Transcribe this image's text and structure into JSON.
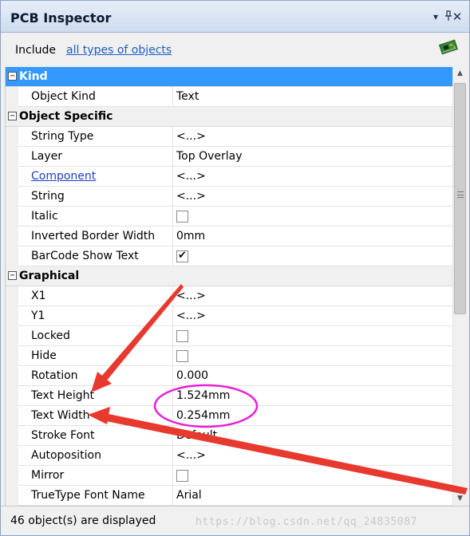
{
  "window": {
    "title": "PCB Inspector"
  },
  "title_controls": {
    "menu": "▾",
    "pin": "ᵩ",
    "close": "✕"
  },
  "include_bar": {
    "label": "Include",
    "link": "all types of objects",
    "icon": "pcb-board-icon"
  },
  "grid": {
    "kind": {
      "label": "Kind",
      "expander": "⊟",
      "rows": [
        {
          "name": "Object Kind",
          "value": "Text"
        }
      ]
    },
    "object_specific": {
      "label": "Object Specific",
      "expander": "⊟",
      "rows": [
        {
          "name": "String Type",
          "value": "<...>"
        },
        {
          "name": "Layer",
          "value": "Top Overlay"
        },
        {
          "name": "Component",
          "value": "<...>"
        },
        {
          "name": "String",
          "value": "<...>"
        },
        {
          "name": "Italic",
          "checked": false
        },
        {
          "name": "Inverted Border Width",
          "value": "0mm"
        },
        {
          "name": "BarCode Show Text",
          "checked": true
        }
      ]
    },
    "graphical": {
      "label": "Graphical",
      "expander": "⊟",
      "rows": [
        {
          "name": "X1",
          "value": "<...>"
        },
        {
          "name": "Y1",
          "value": "<...>"
        },
        {
          "name": "Locked",
          "checked": false
        },
        {
          "name": "Hide",
          "checked": false
        },
        {
          "name": "Rotation",
          "value": "0.000"
        },
        {
          "name": "Text Height",
          "value": "1.524mm"
        },
        {
          "name": "Text Width",
          "value": "0.254mm"
        },
        {
          "name": "Stroke Font",
          "value": "Default"
        },
        {
          "name": "Autoposition",
          "value": "<...>"
        },
        {
          "name": "Mirror",
          "checked": false
        },
        {
          "name": "TrueType Font Name",
          "value": "Arial"
        }
      ]
    }
  },
  "status": {
    "text": "46 object(s) are displayed"
  },
  "watermark": "https://blog.csdn.net/qq_24835087",
  "colors": {
    "selection": "#3399ff",
    "annotation": "#e8392f",
    "highlight_ring": "#e91ed6"
  }
}
